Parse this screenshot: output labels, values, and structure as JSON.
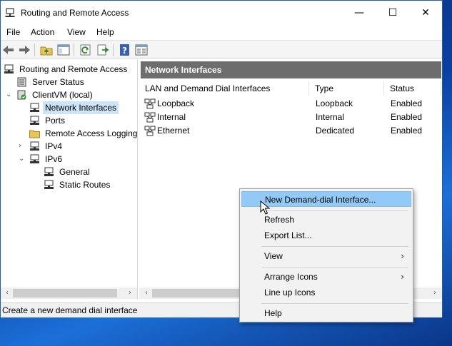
{
  "window": {
    "title": "Routing and Remote Access",
    "minimize": "—",
    "maximize": "☐",
    "close": "✕"
  },
  "menu": [
    "File",
    "Action",
    "View",
    "Help"
  ],
  "tree": {
    "root": "Routing and Remote Access",
    "server_status": "Server Status",
    "server": "ClientVM (local)",
    "network_interfaces": "Network Interfaces",
    "ports": "Ports",
    "remote_access_logging": "Remote Access Logging",
    "ipv4": "IPv4",
    "ipv6": "IPv6",
    "general": "General",
    "static_routes": "Static Routes"
  },
  "list": {
    "title": "Network Interfaces",
    "columns": [
      "LAN and Demand Dial Interfaces",
      "Type",
      "Status"
    ],
    "rows": [
      {
        "name": "Loopback",
        "type": "Loopback",
        "status": "Enabled"
      },
      {
        "name": "Internal",
        "type": "Internal",
        "status": "Enabled"
      },
      {
        "name": "Ethernet",
        "type": "Dedicated",
        "status": "Enabled"
      }
    ]
  },
  "context_menu": {
    "new_demand_dial": "New Demand-dial Interface...",
    "refresh": "Refresh",
    "export_list": "Export List...",
    "view": "View",
    "arrange_icons": "Arrange Icons",
    "line_up_icons": "Line up Icons",
    "help": "Help",
    "submenu_arrow": "›"
  },
  "scroll_arrows": {
    "left": "‹",
    "right": "›"
  },
  "status_bar": "Create a new demand dial interface",
  "colors": {
    "accent_selected": "#cce4f7",
    "menu_highlight": "#91c9f7",
    "list_header": "#6d6d6d"
  }
}
